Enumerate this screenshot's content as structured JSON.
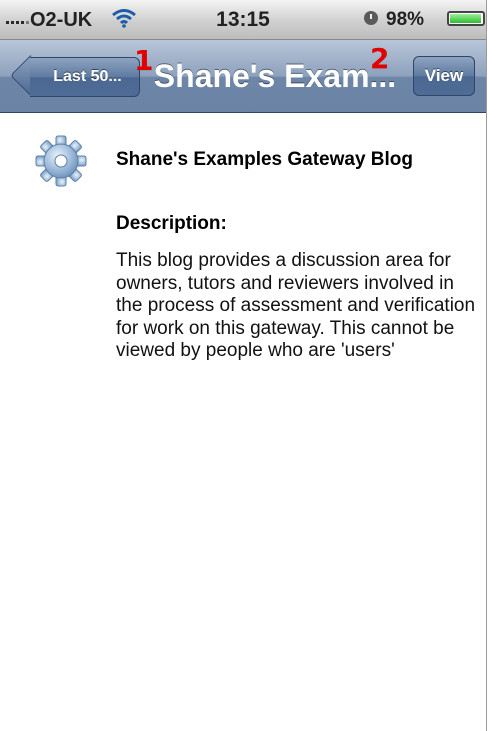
{
  "status_bar": {
    "carrier": "O2-UK",
    "time": "13:15",
    "battery_percent": "98%",
    "battery_level": 0.98,
    "icons": [
      "signal-icon",
      "wifi-icon",
      "alarm-icon",
      "battery-icon"
    ]
  },
  "nav_bar": {
    "back_label": "Last 50...",
    "title": "Shane's Exam...",
    "view_label": "View"
  },
  "annotations": {
    "marker_1": "1",
    "marker_2": "2",
    "color": "#e00000"
  },
  "content": {
    "icon": "gear-icon",
    "blog_title": "Shane's Examples Gateway Blog",
    "description_heading": "Description:",
    "description_text": "This blog provides a discussion area for owners, tutors and reviewers involved in the process of assessment and verification for work on this gateway. This cannot be viewed by people who are 'users'"
  },
  "colors": {
    "nav_bar": "#6d86a7",
    "button": "#4e6c95",
    "background": "#ffffff"
  }
}
